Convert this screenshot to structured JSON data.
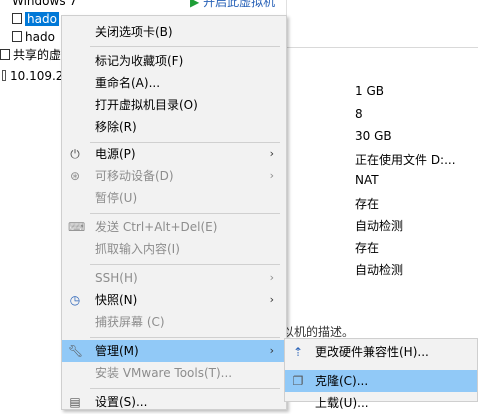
{
  "tree": {
    "items": [
      {
        "label": "Windows 7"
      },
      {
        "label": "hado"
      },
      {
        "label": "hado"
      },
      {
        "label": "共享的虚"
      },
      {
        "label": "10.109.2"
      }
    ]
  },
  "summary": {
    "start_label": "开启此虚拟机",
    "values": [
      "1 GB",
      "8",
      "30 GB",
      "正在使用文件 D:...",
      "NAT",
      "存在",
      "自动检测",
      "存在",
      "自动检测"
    ],
    "description_hint": "以机的描述。"
  },
  "context_menu": {
    "items": [
      {
        "label": "关闭选项卡(B)"
      },
      {
        "label": "标记为收藏项(F)"
      },
      {
        "label": "重命名(A)..."
      },
      {
        "label": "打开虚拟机目录(O)"
      },
      {
        "label": "移除(R)"
      },
      {
        "label": "电源(P)"
      },
      {
        "label": "可移动设备(D)"
      },
      {
        "label": "暂停(U)"
      },
      {
        "label": "发送 Ctrl+Alt+Del(E)"
      },
      {
        "label": "抓取输入内容(I)"
      },
      {
        "label": "SSH(H)"
      },
      {
        "label": "快照(N)"
      },
      {
        "label": "捕获屏幕 (C)"
      },
      {
        "label": "管理(M)"
      },
      {
        "label": "安装 VMware Tools(T)..."
      },
      {
        "label": "设置(S)..."
      }
    ]
  },
  "submenu": {
    "items": [
      {
        "label": "更改硬件兼容性(H)..."
      },
      {
        "label": "克隆(C)..."
      },
      {
        "label": "上载(U)..."
      }
    ]
  }
}
